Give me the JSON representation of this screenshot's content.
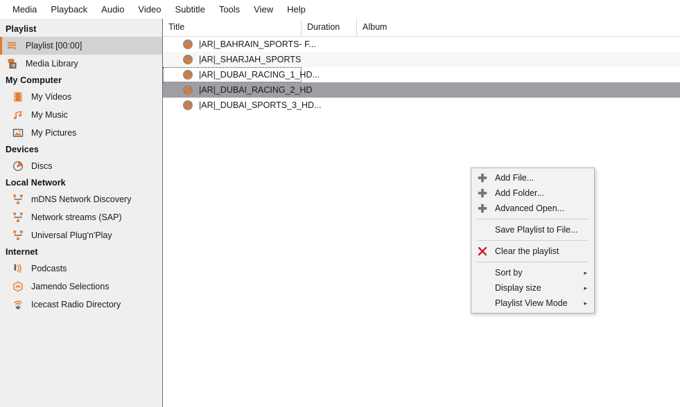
{
  "menubar": {
    "items": [
      {
        "label": "Media",
        "name": "menu-media"
      },
      {
        "label": "Playback",
        "name": "menu-playback"
      },
      {
        "label": "Audio",
        "name": "menu-audio"
      },
      {
        "label": "Video",
        "name": "menu-video"
      },
      {
        "label": "Subtitle",
        "name": "menu-subtitle"
      },
      {
        "label": "Tools",
        "name": "menu-tools"
      },
      {
        "label": "View",
        "name": "menu-view"
      },
      {
        "label": "Help",
        "name": "menu-help"
      }
    ]
  },
  "sidebar": {
    "sections": [
      {
        "header": "Playlist",
        "items": [
          {
            "label": "Playlist [00:00]",
            "icon": "playlist-icon",
            "active": true
          },
          {
            "label": "Media Library",
            "icon": "media-library-icon",
            "active": false
          }
        ]
      },
      {
        "header": "My Computer",
        "items": [
          {
            "label": "My Videos",
            "icon": "film-icon",
            "active": false
          },
          {
            "label": "My Music",
            "icon": "music-note-icon",
            "active": false
          },
          {
            "label": "My Pictures",
            "icon": "picture-icon",
            "active": false
          }
        ]
      },
      {
        "header": "Devices",
        "items": [
          {
            "label": "Discs",
            "icon": "disc-icon",
            "active": false
          }
        ]
      },
      {
        "header": "Local Network",
        "items": [
          {
            "label": "mDNS Network Discovery",
            "icon": "network-icon",
            "active": false
          },
          {
            "label": "Network streams (SAP)",
            "icon": "network-icon",
            "active": false
          },
          {
            "label": "Universal Plug'n'Play",
            "icon": "network-icon",
            "active": false
          }
        ]
      },
      {
        "header": "Internet",
        "items": [
          {
            "label": "Podcasts",
            "icon": "podcast-icon",
            "active": false
          },
          {
            "label": "Jamendo Selections",
            "icon": "jamendo-icon",
            "active": false
          },
          {
            "label": "Icecast Radio Directory",
            "icon": "icecast-icon",
            "active": false
          }
        ]
      }
    ]
  },
  "playlist": {
    "columns": [
      {
        "label": "Title",
        "name": "column-title"
      },
      {
        "label": "Duration",
        "name": "column-duration"
      },
      {
        "label": "Album",
        "name": "column-album"
      }
    ],
    "rows": [
      {
        "title": "|AR|_BAHRAIN_SPORTS- F...",
        "duration": "",
        "album": "",
        "state": "normal"
      },
      {
        "title": "|AR|_SHARJAH_SPORTS",
        "duration": "",
        "album": "",
        "state": "alt"
      },
      {
        "title": "|AR|_DUBAI_RACING_1_HD...",
        "duration": "",
        "album": "",
        "state": "focused"
      },
      {
        "title": "|AR|_DUBAI_RACING_2_HD",
        "duration": "",
        "album": "",
        "state": "selected"
      },
      {
        "title": "|AR|_DUBAI_SPORTS_3_HD...",
        "duration": "",
        "album": "",
        "state": "normal"
      }
    ]
  },
  "context_menu": {
    "items": [
      {
        "label": "Add File...",
        "icon": "plus-icon",
        "submenu": false
      },
      {
        "label": "Add Folder...",
        "icon": "plus-icon",
        "submenu": false
      },
      {
        "label": "Advanced Open...",
        "icon": "plus-icon",
        "submenu": false
      },
      {
        "separator": true
      },
      {
        "label": "Save Playlist to File...",
        "icon": "none",
        "submenu": false
      },
      {
        "separator": true
      },
      {
        "label": "Clear the playlist",
        "icon": "x-icon",
        "submenu": false
      },
      {
        "separator": true
      },
      {
        "label": "Sort by",
        "icon": "none",
        "submenu": true
      },
      {
        "label": "Display size",
        "icon": "none",
        "submenu": true
      },
      {
        "label": "Playlist View Mode",
        "icon": "none",
        "submenu": true
      }
    ],
    "submenu_arrow": "▸"
  },
  "colors": {
    "accent_orange": "#e8792a",
    "sidebar_bg": "#efefef",
    "selected_row": "#9e9ea3",
    "clear_icon_red": "#cc2222",
    "plus_icon_gray": "#767676"
  }
}
